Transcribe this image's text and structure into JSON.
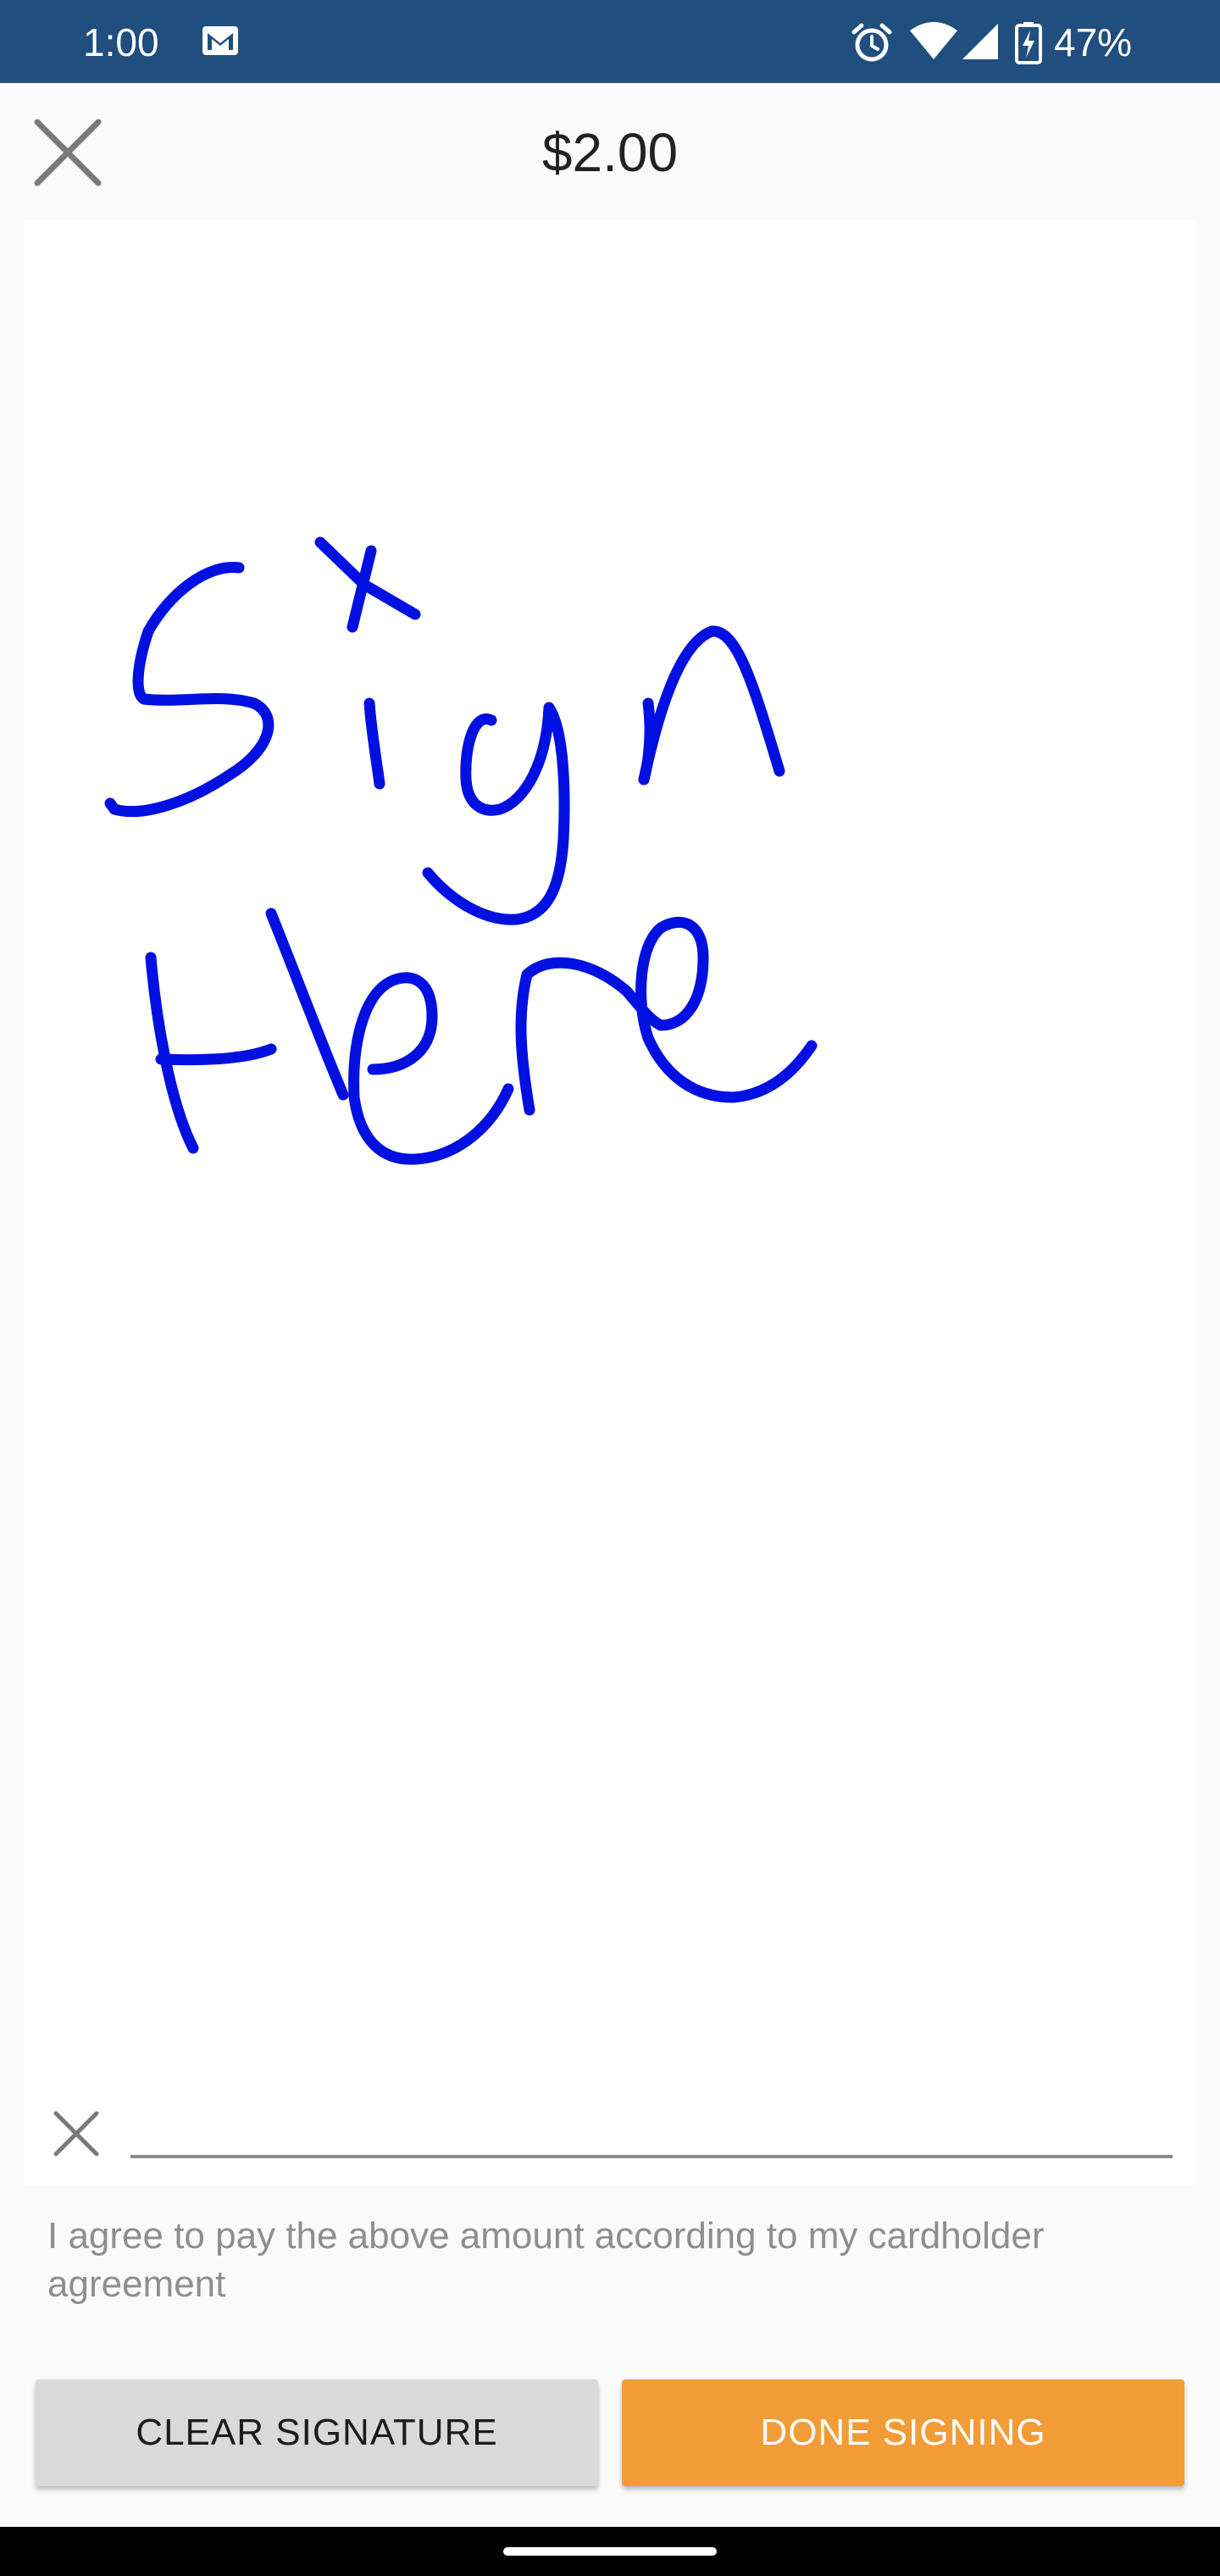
{
  "status_bar": {
    "time": "1:00",
    "battery_percent": "47%",
    "icons": [
      "gmail-icon",
      "alarm-icon",
      "wifi-icon",
      "cell-signal-icon",
      "battery-charging-icon"
    ]
  },
  "header": {
    "amount": "$2.00",
    "close_icon": "close-icon"
  },
  "signature_pad": {
    "ink_color": "#0010e0",
    "signature_image_text": "Sign Here",
    "sign_line_icon": "x-icon"
  },
  "agreement_text": "I agree to pay the above amount according to my cardholder agreement",
  "buttons": {
    "clear_label": "CLEAR SIGNATURE",
    "done_label": "DONE SIGNING"
  },
  "colors": {
    "status_bar": "#204e7e",
    "done_button": "#f29c38",
    "clear_button": "#d9d9d9"
  }
}
